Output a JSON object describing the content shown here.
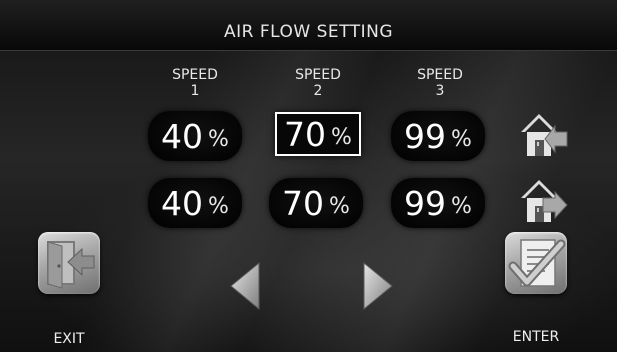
{
  "header": {
    "title": "AIR FLOW SETTING"
  },
  "columns": [
    {
      "label": "SPEED",
      "number": "1"
    },
    {
      "label": "SPEED",
      "number": "2"
    },
    {
      "label": "SPEED",
      "number": "3"
    }
  ],
  "rows": [
    {
      "name": "supply",
      "icon": "house-arrow-in-icon",
      "values": [
        {
          "value": "40",
          "unit": "%"
        },
        {
          "value": "70",
          "unit": "%"
        },
        {
          "value": "99",
          "unit": "%"
        }
      ],
      "selected_index": 1
    },
    {
      "name": "exhaust",
      "icon": "house-arrow-out-icon",
      "values": [
        {
          "value": "40",
          "unit": "%"
        },
        {
          "value": "70",
          "unit": "%"
        },
        {
          "value": "99",
          "unit": "%"
        }
      ]
    }
  ],
  "footer": {
    "exit_label": "EXIT",
    "exit_icon": "door-exit-icon",
    "enter_label": "ENTER",
    "enter_icon": "checklist-icon",
    "prev_icon": "triangle-left-icon",
    "next_icon": "triangle-right-icon"
  }
}
